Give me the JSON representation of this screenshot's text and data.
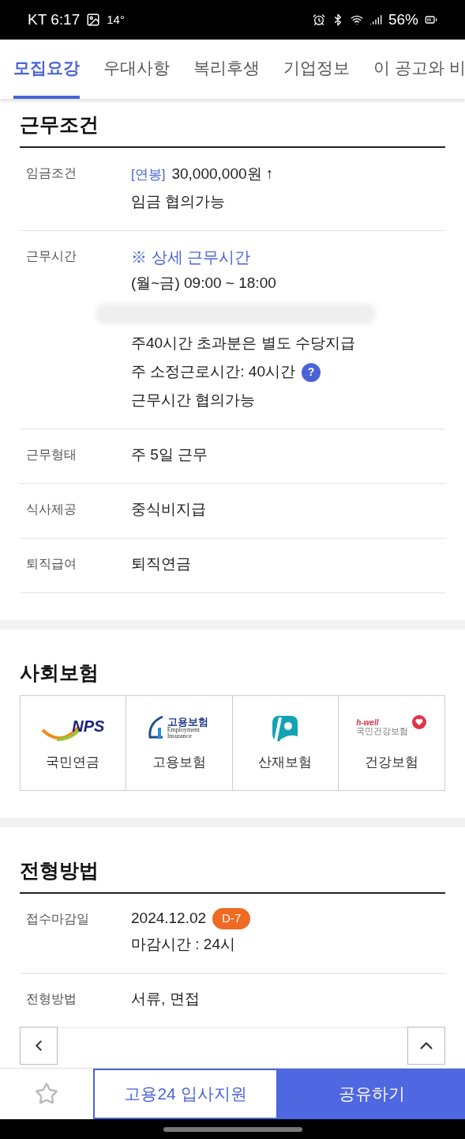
{
  "status_bar": {
    "carrier_time": "KT 6:17",
    "temperature": "14°",
    "battery": "56%"
  },
  "tabs": [
    {
      "label": "모집요강",
      "selected": true
    },
    {
      "label": "우대사항",
      "selected": false
    },
    {
      "label": "복리후생",
      "selected": false
    },
    {
      "label": "기업정보",
      "selected": false
    },
    {
      "label": "이 공고와 비",
      "selected": false
    }
  ],
  "work_conditions": {
    "title": "근무조건",
    "rows": [
      {
        "label": "임금조건",
        "lines": [
          {
            "kind": "salary",
            "tag": "[연봉]",
            "text": "30,000,000원 ↑"
          },
          {
            "kind": "plain",
            "text": "임금 협의가능"
          }
        ]
      },
      {
        "label": "근무시간",
        "lines": [
          {
            "kind": "link",
            "text": "※ 상세 근무시간"
          },
          {
            "kind": "plain",
            "text": "(월~금) 09:00 ~ 18:00"
          },
          {
            "kind": "redacted"
          },
          {
            "kind": "plain",
            "text": "주40시간 초과분은 별도 수당지급"
          },
          {
            "kind": "help",
            "text": "주 소정근로시간: 40시간",
            "icon": "?"
          },
          {
            "kind": "plain",
            "text": "근무시간 협의가능"
          }
        ]
      },
      {
        "label": "근무형태",
        "lines": [
          {
            "kind": "plain",
            "text": "주 5일 근무"
          }
        ]
      },
      {
        "label": "식사제공",
        "lines": [
          {
            "kind": "plain",
            "text": "중식비지급"
          }
        ]
      },
      {
        "label": "퇴직급여",
        "lines": [
          {
            "kind": "plain",
            "text": "퇴직연금"
          }
        ]
      }
    ]
  },
  "social_insurance": {
    "title": "사회보험",
    "items": [
      {
        "kind": "nps",
        "logo_text": "NPS",
        "label": "국민연금"
      },
      {
        "kind": "ei",
        "logo_text": "고용보험",
        "logo_subtext": "Employment Insurance",
        "label": "고용보험"
      },
      {
        "kind": "comwel",
        "label": "산재보험"
      },
      {
        "kind": "nhis",
        "logo_text": "h-well",
        "logo_subtext": "국민건강보험",
        "label": "건강보험"
      }
    ]
  },
  "selection": {
    "title": "전형방법",
    "rows": [
      {
        "label": "접수마감일",
        "lines": [
          {
            "kind": "deadline",
            "text": "2024.12.02",
            "badge": "D-7"
          },
          {
            "kind": "plain",
            "text": "마감시간 : 24시"
          }
        ]
      },
      {
        "label": "전형방법",
        "lines": [
          {
            "kind": "plain",
            "text": "서류, 면접"
          }
        ]
      }
    ]
  },
  "bottom_bar": {
    "favorite": false,
    "apply_button": "고용24 입사지원",
    "share_button": "공유하기"
  }
}
